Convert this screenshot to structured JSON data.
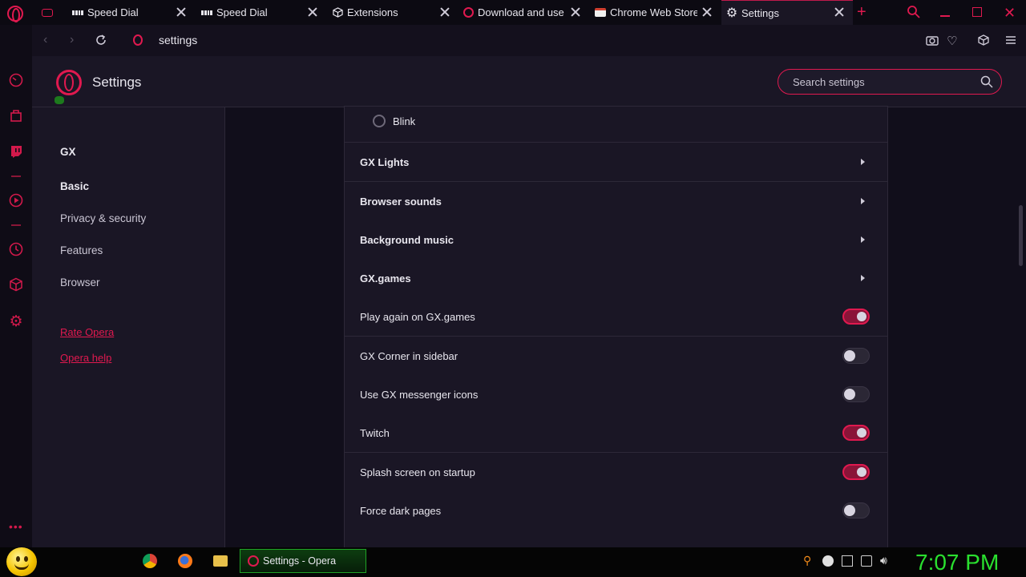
{
  "tabs": [
    {
      "label": "Speed Dial",
      "icon": "grid-icon"
    },
    {
      "label": "Speed Dial",
      "icon": "grid-icon"
    },
    {
      "label": "Extensions",
      "icon": "cube-icon"
    },
    {
      "label": "Download and use C",
      "icon": "opera-icon"
    },
    {
      "label": "Chrome Web Store -",
      "icon": "store-icon"
    },
    {
      "label": "Settings",
      "icon": "gear-icon",
      "active": true
    }
  ],
  "address": {
    "url": "settings"
  },
  "header": {
    "title": "Settings",
    "search_placeholder": "Search settings"
  },
  "nav": {
    "items": [
      "GX",
      "Basic",
      "Privacy & security",
      "Features",
      "Browser"
    ],
    "links": [
      "Rate Opera",
      "Opera help"
    ]
  },
  "content": {
    "radio_option": "Blink",
    "rows": [
      {
        "label": "GX Lights",
        "type": "chevron"
      },
      {
        "label": "Browser sounds",
        "type": "chevron"
      },
      {
        "label": "Background music",
        "type": "chevron"
      },
      {
        "label": "GX.games",
        "type": "chevron"
      },
      {
        "label": "Play again on GX.games",
        "type": "toggle",
        "on": true
      },
      {
        "label": "GX Corner in sidebar",
        "type": "toggle",
        "on": false
      },
      {
        "label": "Use GX messenger icons",
        "type": "toggle",
        "on": false
      },
      {
        "label": "Twitch",
        "type": "toggle",
        "on": true
      },
      {
        "label": "Splash screen on startup",
        "type": "toggle",
        "on": true
      },
      {
        "label": "Force dark pages",
        "type": "toggle",
        "on": false
      }
    ]
  },
  "taskbar": {
    "window_label": "Settings - Opera",
    "clock": "7:07 PM"
  },
  "colors": {
    "accent": "#e0194f",
    "background": "#1a1625",
    "clock": "#2ae02f"
  }
}
